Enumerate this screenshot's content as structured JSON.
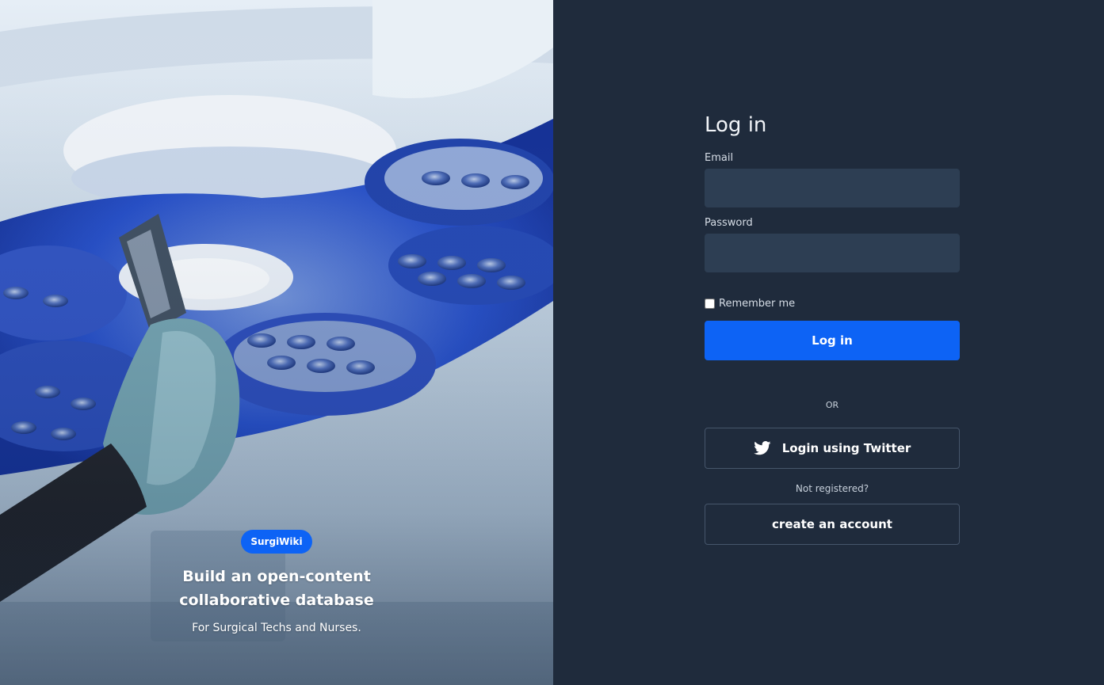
{
  "hero": {
    "brand": "SurgiWiki",
    "title": "Build an open-content collaborative database",
    "subtitle": "For Surgical Techs and Nurses."
  },
  "login": {
    "heading": "Log in",
    "email_label": "Email",
    "email_value": "",
    "password_label": "Password",
    "password_value": "",
    "remember_label": "Remember me",
    "remember_checked": false,
    "submit_label": "Log in",
    "divider": "OR",
    "twitter_label": "Login using Twitter",
    "twitter_icon": "twitter-bird-icon",
    "not_registered": "Not registered?",
    "create_account_label": "create an account"
  },
  "colors": {
    "accent": "#0d63f5",
    "panel_bg": "#1f2b3c",
    "input_bg": "#2d3e53"
  }
}
